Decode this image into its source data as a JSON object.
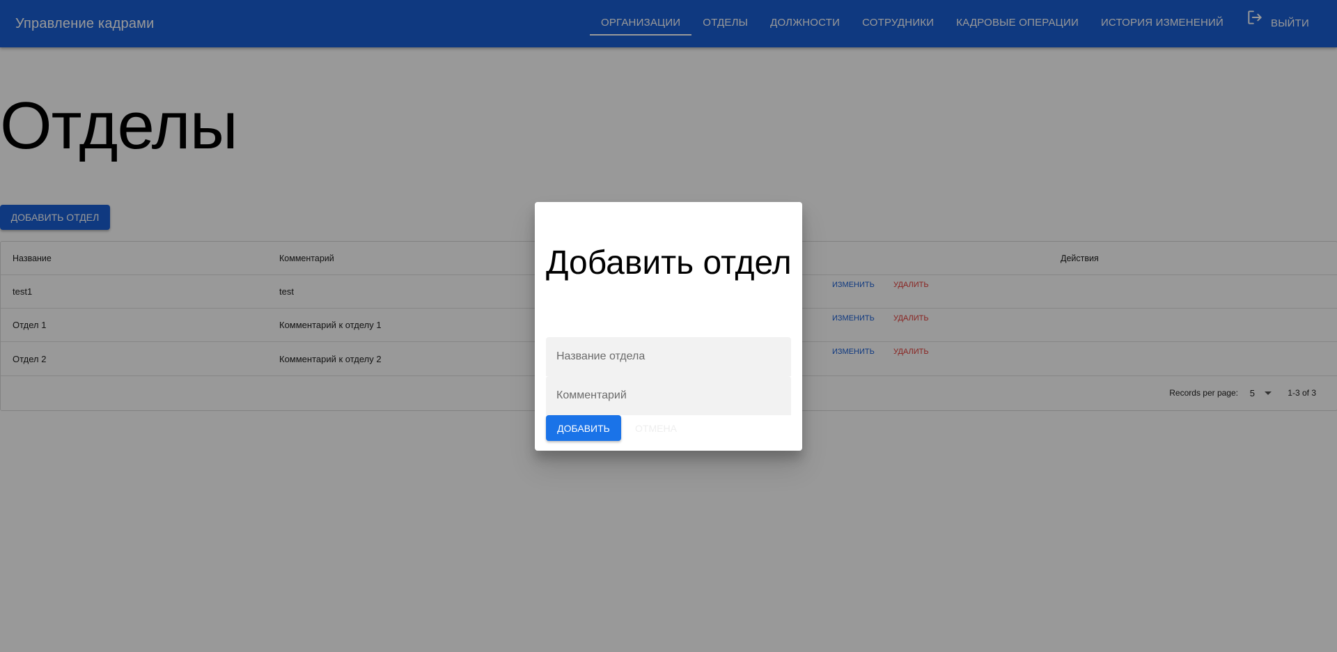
{
  "app": {
    "title": "Управление кадрами",
    "colors": {
      "primary": "#1a5fd6",
      "danger": "#e53935",
      "dialog_button": "#1a73e8"
    }
  },
  "nav": {
    "items": [
      {
        "label": "ОРГАНИЗАЦИИ",
        "active": true
      },
      {
        "label": "ОТДЕЛЫ"
      },
      {
        "label": "ДОЛЖНОСТИ"
      },
      {
        "label": "СОТРУДНИКИ"
      },
      {
        "label": "КАДРОВЫЕ ОПЕРАЦИИ"
      },
      {
        "label": "ИСТОРИЯ ИЗМЕНЕНИЙ"
      }
    ],
    "logout": {
      "label": "ВЫЙТИ",
      "icon": "logout-icon"
    }
  },
  "page": {
    "title": "Отделы",
    "add_button": "ДОБАВИТЬ ОТДЕЛ"
  },
  "table": {
    "headers": {
      "name": "Название",
      "comment": "Комментарий",
      "actions": "Действия"
    },
    "rows": [
      {
        "name": "test1",
        "comment": "test",
        "edit": "ИЗМЕНИТЬ",
        "delete": "УДАЛИТЬ"
      },
      {
        "name": "Отдел 1",
        "comment": "Комментарий к отделу 1",
        "edit": "ИЗМЕНИТЬ",
        "delete": "УДАЛИТЬ"
      },
      {
        "name": "Отдел 2",
        "comment": "Комментарий к отделу 2",
        "edit": "ИЗМЕНИТЬ",
        "delete": "УДАЛИТЬ"
      }
    ],
    "footer": {
      "records_per_page_label": "Records per page:",
      "records_per_page_value": "5",
      "range": "1-3 of 3"
    }
  },
  "dialog": {
    "title": "Добавить отдел",
    "name_field": {
      "placeholder": "Название отдела",
      "value": ""
    },
    "comment_field": {
      "placeholder": "Комментарий",
      "value": ""
    },
    "add_button": "ДОБАВИТЬ",
    "cancel_button": "ОТМЕНА"
  }
}
